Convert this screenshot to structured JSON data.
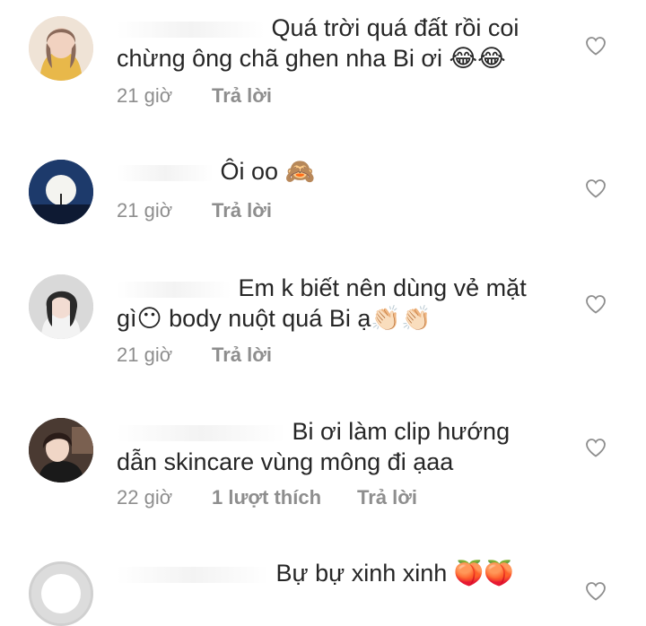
{
  "comments": [
    {
      "username": "username",
      "text": "Quá trời quá đất rồi coi chừng ông chã ghen nha Bi ơi 😂😂",
      "time": "21 giờ",
      "likes": "",
      "reply_label": "Trả lời",
      "avatar_icon": "profile-photo"
    },
    {
      "username": "username",
      "text": "Ôi oo 🙈",
      "time": "21 giờ",
      "likes": "",
      "reply_label": "Trả lời",
      "avatar_icon": "profile-photo"
    },
    {
      "username": "username",
      "text": "Em k biết nên dùng vẻ mặt gì😶 body nuột quá Bi ạ👏🏻👏🏻",
      "time": "21 giờ",
      "likes": "",
      "reply_label": "Trả lời",
      "avatar_icon": "profile-photo"
    },
    {
      "username": "username",
      "text": "Bi ơi làm clip hướng dẫn skincare vùng mông đi ạaa",
      "time": "22 giờ",
      "likes": "1 lượt thích",
      "reply_label": "Trả lời",
      "avatar_icon": "profile-photo"
    },
    {
      "username": "username",
      "text": "Bự bự xinh xinh 🍑🍑",
      "time": "",
      "likes": "",
      "reply_label": "",
      "avatar_icon": "default-avatar"
    }
  ],
  "colors": {
    "text": "#262626",
    "meta": "#8e8e8e",
    "heart": "#8e8e8e"
  }
}
